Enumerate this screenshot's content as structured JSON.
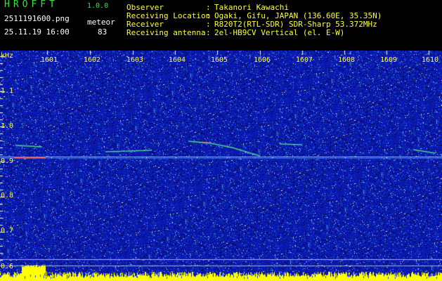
{
  "header": {
    "app_title": "HROFFT",
    "app_version": "1.0.0",
    "filename": "2511191600.png",
    "datetime": "25.11.19 16:00",
    "meteor_label": "meteor",
    "meteor_count": "83",
    "info": [
      {
        "label": "Observer",
        "value": "Takanori Kawachi"
      },
      {
        "label": "Receiving Location",
        "value": "Ogaki, Gifu, JAPAN (136.60E, 35.35N)"
      },
      {
        "label": "Receiver",
        "value": "R820T2(RTL-SDR) SDR-Sharp 53.372MHz"
      },
      {
        "label": "Receiving antenna",
        "value": "2el-HB9CV Vertical (el. E-W)"
      }
    ]
  },
  "axis": {
    "unit": "kHz",
    "x_ticks": [
      "1601",
      "1602",
      "1603",
      "1604",
      "1605",
      "1606",
      "1607",
      "1608",
      "1609",
      "1610"
    ],
    "y_ticks": [
      "1.1",
      "1.0",
      "0.9",
      "0.8",
      "0.7",
      "0.6"
    ]
  },
  "colors": {
    "background": "#000000",
    "spectro_base": "#0a1aa0",
    "header_green": "#35e13a",
    "label_yellow": "#ffff3a"
  }
}
